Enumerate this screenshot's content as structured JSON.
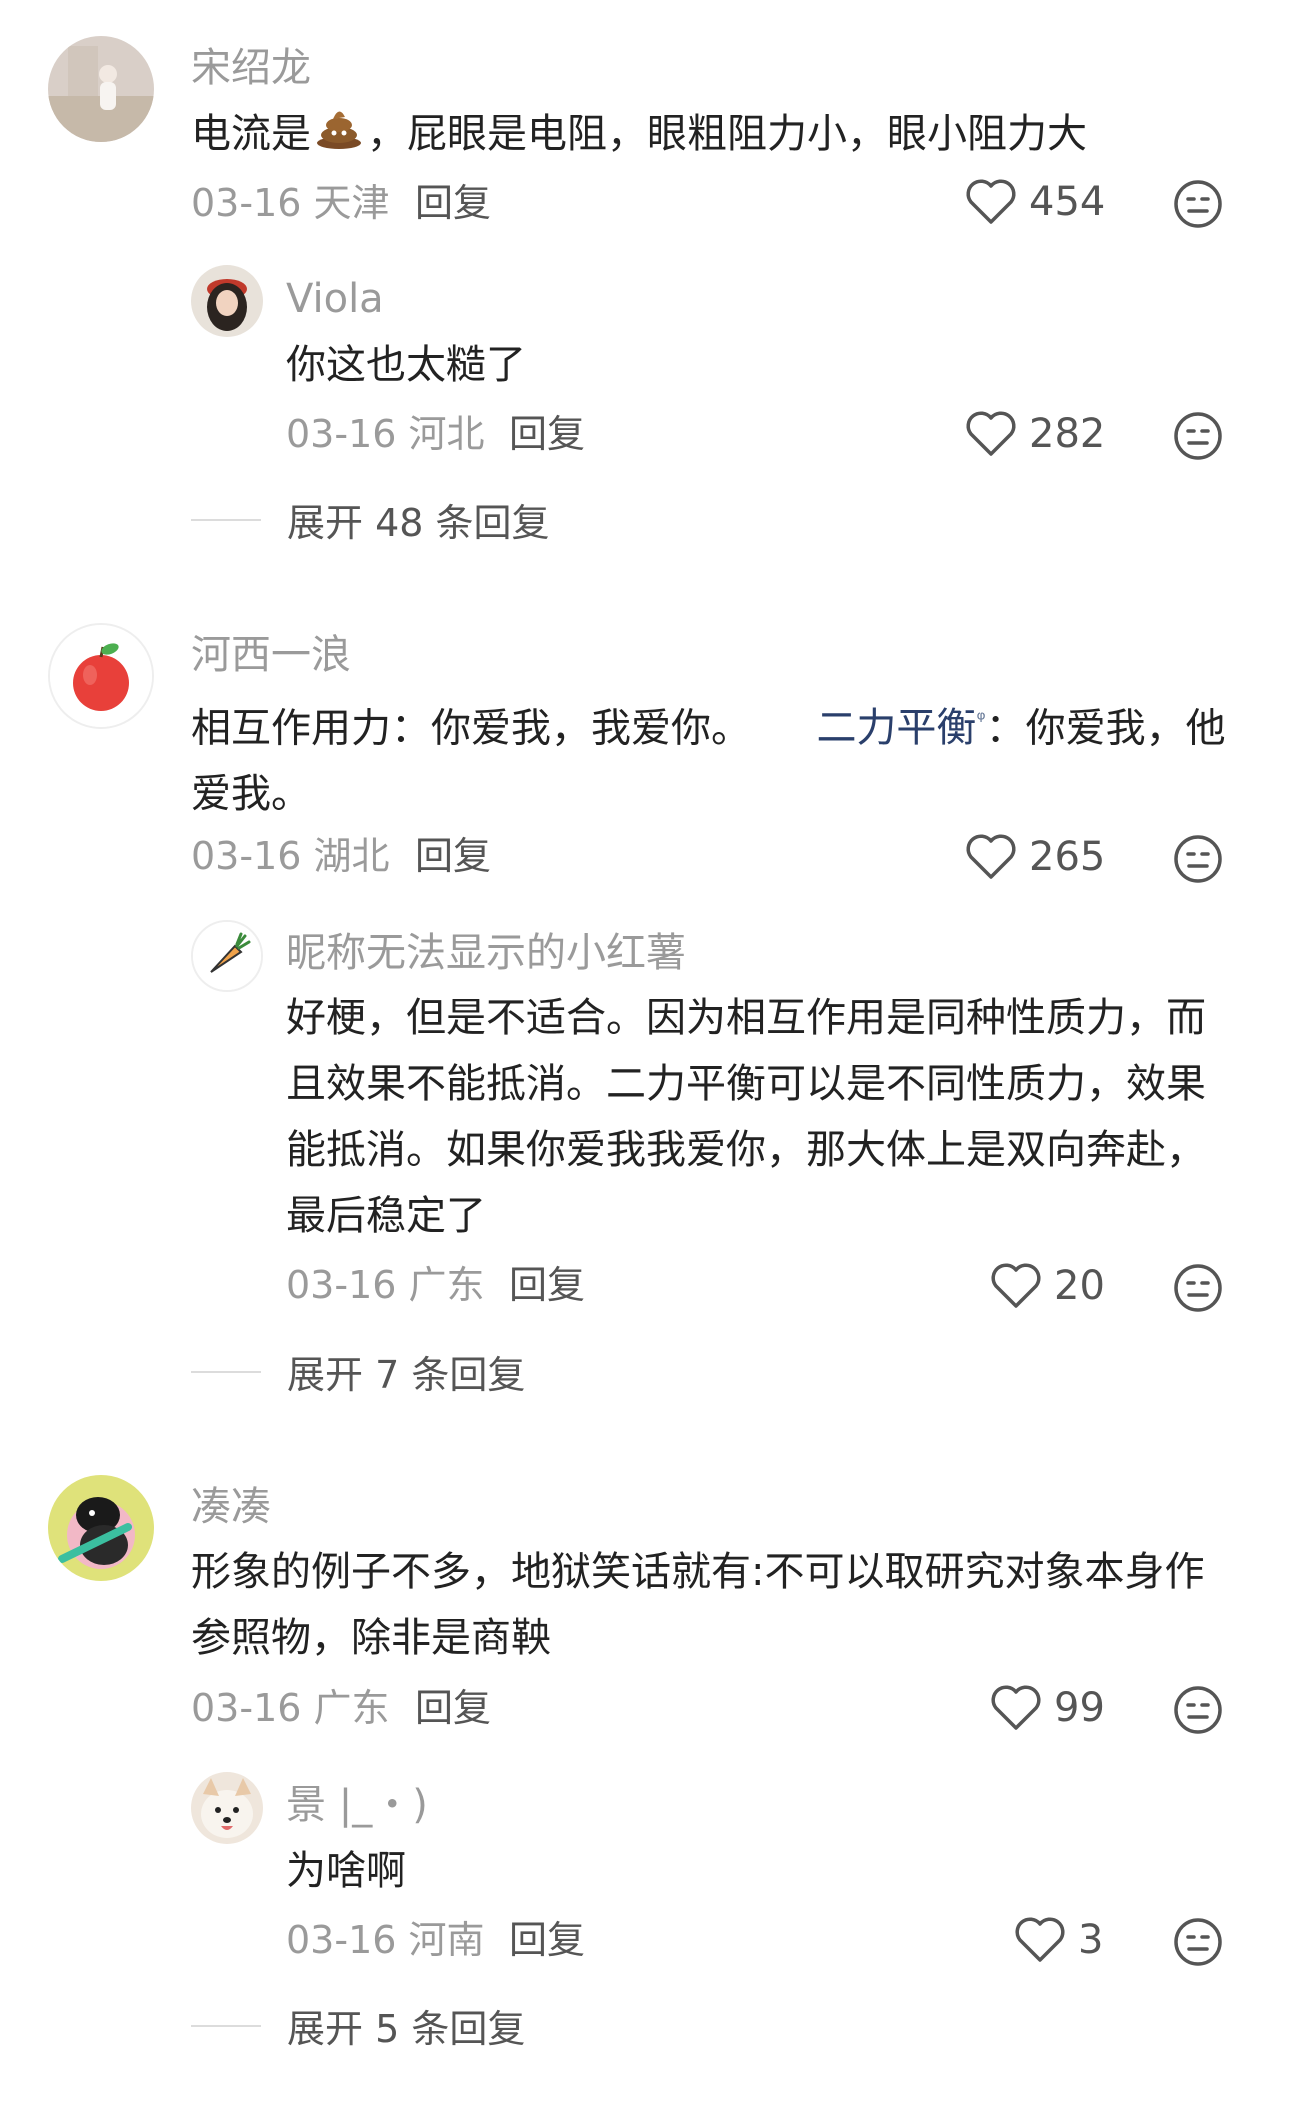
{
  "comments": [
    {
      "user": "宋绍龙",
      "text_before": "电流是",
      "text_emoji": "💩",
      "text_after": "，屁眼是电阻，眼粗阻力小，眼小阻力大",
      "date": "03-16",
      "location": "天津",
      "reply_label": "回复",
      "likes": "454",
      "avatar_icon": "girl-photo-avatar"
    },
    {
      "user": "Viola",
      "text": "你这也太糙了",
      "date": "03-16",
      "location": "河北",
      "reply_label": "回复",
      "likes": "282",
      "avatar_icon": "girl-selfie-avatar"
    },
    {
      "expand_label": "展开 48 条回复"
    },
    {
      "user": "河西一浪",
      "text_before": "相互作用力：你爱我，我爱你。",
      "link_text": "二力平衡",
      "link_mark": "ᵠ",
      "text_after": "：你爱我，他爱我。",
      "date": "03-16",
      "location": "湖北",
      "reply_label": "回复",
      "likes": "265",
      "avatar_icon": "apple-avatar"
    },
    {
      "user": "昵称无法显示的小红薯",
      "text": "好梗，但是不适合。因为相互作用是同种性质力，而且效果不能抵消。二力平衡可以是不同性质力，效果能抵消。如果你爱我我爱你，那大体上是双向奔赴，最后稳定了",
      "date": "03-16",
      "location": "广东",
      "reply_label": "回复",
      "likes": "20",
      "avatar_icon": "carrot-avatar"
    },
    {
      "expand_label": "展开 7 条回复"
    },
    {
      "user": "凑凑",
      "text": "形象的例子不多，地狱笑话就有:不可以取研究对象本身作参照物，除非是商鞅",
      "date": "03-16",
      "location": "广东",
      "reply_label": "回复",
      "likes": "99",
      "avatar_icon": "cartoon-guitar-avatar"
    },
    {
      "user": "景 |_・)",
      "text": "为啥啊",
      "date": "03-16",
      "location": "河南",
      "reply_label": "回复",
      "likes": "3",
      "avatar_icon": "dog-avatar"
    },
    {
      "expand_label": "展开 5 条回复"
    }
  ],
  "icons": {
    "like": "heart-outline-icon",
    "dislike": "meh-face-icon"
  },
  "colors": {
    "name": "#9a9a9a",
    "text": "#222222",
    "link": "#2a3f6b"
  }
}
